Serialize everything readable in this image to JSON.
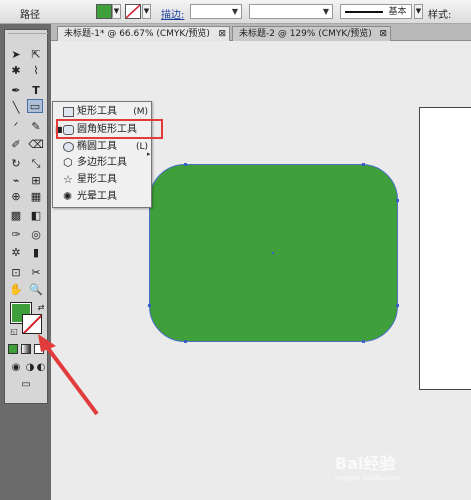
{
  "control_bar": {
    "path_label": "路径",
    "fill_color": "#3f9f3a",
    "stroke_label": "描边:",
    "stroke_style_label": "基本",
    "style_label": "样式:"
  },
  "tabs": [
    {
      "label": "未标题-1* @ 66.67% (CMYK/预览)",
      "close": "⊠"
    },
    {
      "label": "未标题-2 @ 129% (CMYK/预览)",
      "close": "⊠"
    }
  ],
  "flyout": {
    "items": [
      {
        "label": "矩形工具",
        "shortcut": "(M)",
        "icon": "rectangle-icon"
      },
      {
        "label": "圆角矩形工具",
        "shortcut": "",
        "icon": "rounded-rectangle-icon",
        "selected": true
      },
      {
        "label": "椭圆工具",
        "shortcut": "(L)",
        "icon": "ellipse-icon"
      },
      {
        "label": "多边形工具",
        "shortcut": "",
        "icon": "polygon-icon"
      },
      {
        "label": "星形工具",
        "shortcut": "",
        "icon": "star-icon"
      },
      {
        "label": "光晕工具",
        "shortcut": "",
        "icon": "flare-icon"
      }
    ],
    "selected_bullet": "■"
  },
  "colors": {
    "shape_fill": "#3f9f3a",
    "highlight": "#e23b3b",
    "selection": "#3a5fc0"
  },
  "watermark": {
    "text": "Bai经验",
    "sub": "jingyan.baidu.com"
  }
}
